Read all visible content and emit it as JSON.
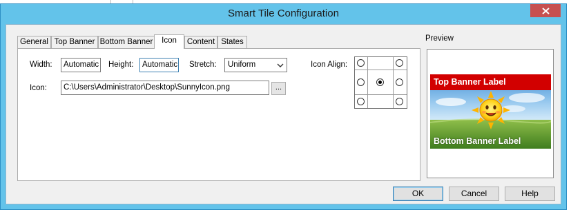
{
  "window": {
    "title": "Smart Tile Configuration"
  },
  "tabs": [
    {
      "label": "General"
    },
    {
      "label": "Top Banner"
    },
    {
      "label": "Bottom Banner"
    },
    {
      "label": "Icon",
      "active": true
    },
    {
      "label": "Content"
    },
    {
      "label": "States"
    }
  ],
  "icon_tab": {
    "width_label": "Width:",
    "width_value": "Automatic",
    "height_label": "Height:",
    "height_value": "Automatic",
    "stretch_label": "Stretch:",
    "stretch_value": "Uniform",
    "icon_align_label": "Icon Align:",
    "icon_label": "Icon:",
    "icon_path": "C:\\Users\\Administrator\\Desktop\\SunnyIcon.png",
    "browse_label": "...",
    "align_selected": "middle-center"
  },
  "preview": {
    "label": "Preview",
    "top_banner_text": "Top Banner Label",
    "bottom_banner_text": "Bottom Banner Label",
    "top_banner_color": "#d20000"
  },
  "buttons": {
    "ok": "OK",
    "cancel": "Cancel",
    "help": "Help"
  },
  "colors": {
    "title_bar": "#63c3ea",
    "close_button": "#c75050"
  }
}
